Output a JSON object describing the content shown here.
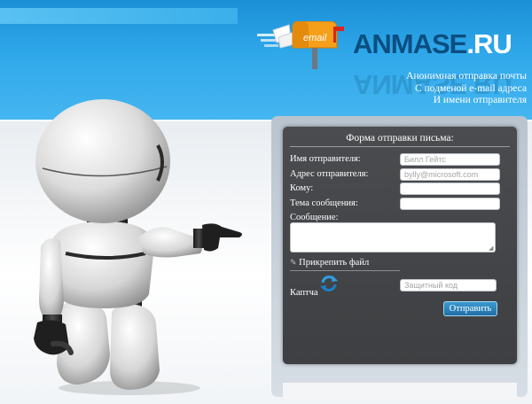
{
  "brand": {
    "icon_label": "email",
    "name_main": "ANMASE",
    "name_tld": ".RU"
  },
  "tagline": [
    "Анонимная отправка почты",
    "С подменой e-mail адреса",
    "И имени отправителя"
  ],
  "form": {
    "title": "Форма отправки письма:",
    "sender_name_label": "Имя отправителя:",
    "sender_name_placeholder": "Билл Гейтс",
    "sender_address_label": "Адрес отправителя:",
    "sender_address_placeholder": "bylly@microsoft.com",
    "to_label": "Кому:",
    "subject_label": "Тема сообщения:",
    "message_label": "Сообщение:",
    "attach_label": "Прикрепить файл",
    "captcha_label": "Каптча",
    "captcha_placeholder": "Защитный код",
    "submit_label": "Отправить"
  },
  "colors": {
    "sky": "#2fa8ea",
    "logo_dark": "#0b4e80",
    "form_bg": "#444649",
    "button": "#2a80b9"
  }
}
